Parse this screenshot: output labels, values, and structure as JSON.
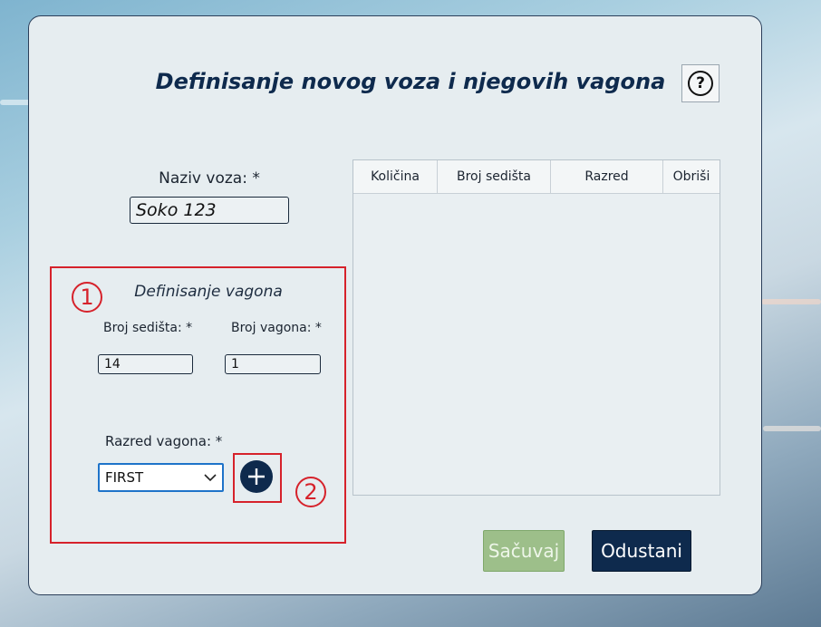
{
  "form": {
    "title": "Definisanje novog voza i njegovih vagona",
    "help_label": "?",
    "train_name_label": "Naziv voza: *",
    "train_name_value": "Soko 123"
  },
  "wagon_section": {
    "title": "Definisanje vagona",
    "seats_label": "Broj sedišta: *",
    "seats_value": "14",
    "wagon_number_label": "Broj vagona: *",
    "wagon_number_value": "1",
    "class_label": "Razred vagona: *",
    "class_value": "FIRST",
    "add_label": "+"
  },
  "table": {
    "columns": [
      "Količina",
      "Broj sedišta",
      "Razred",
      "Obriši"
    ],
    "rows": []
  },
  "actions": {
    "save_label": "Sačuvaj",
    "cancel_label": "Odustani"
  },
  "annotations": {
    "marker_1": "1",
    "marker_2": "2",
    "color": "#d6222b"
  },
  "colors": {
    "primary": "#0e2a4d",
    "save_disabled": "#9dbf8a",
    "select_border": "#1e73c9"
  }
}
